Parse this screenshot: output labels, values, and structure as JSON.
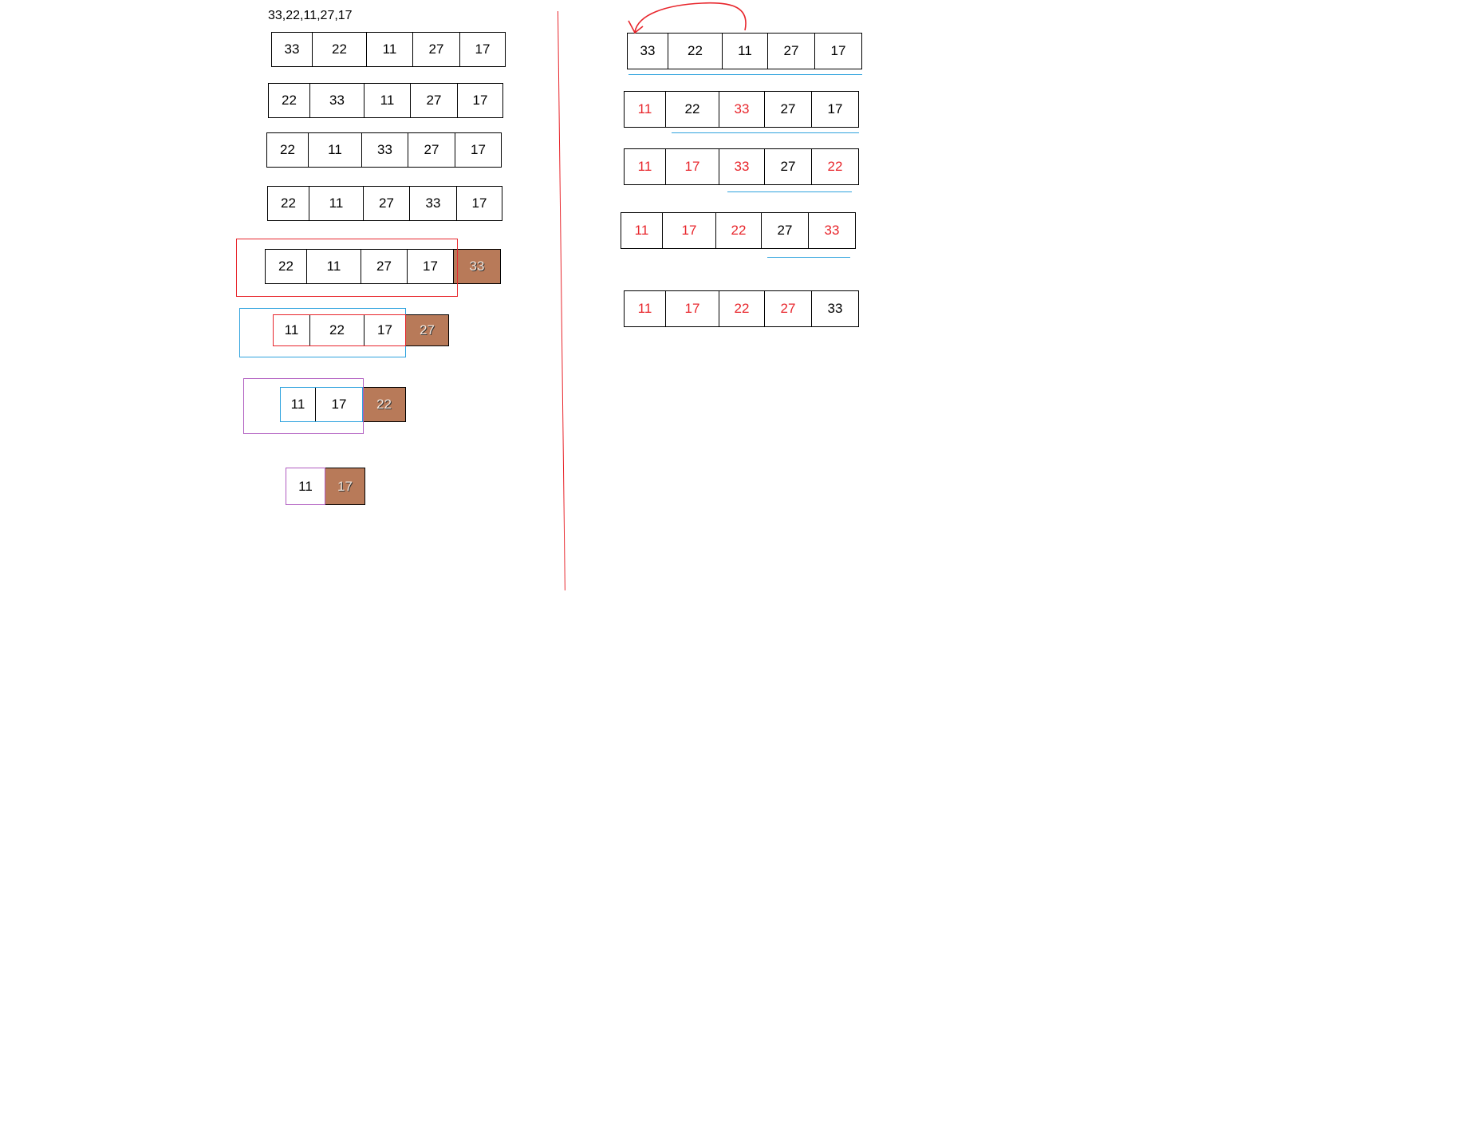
{
  "colors": {
    "black": "#000000",
    "red": "#e8262c",
    "cyan": "#2fa3de",
    "purple": "#b05cc0",
    "sorted_fill": "#b87a59"
  },
  "left_panel": {
    "input_label": "33,22,11,27,17",
    "rows": [
      [
        "33",
        "22",
        "11",
        "27",
        "17"
      ],
      [
        "22",
        "33",
        "11",
        "27",
        "17"
      ],
      [
        "22",
        "11",
        "33",
        "27",
        "17"
      ],
      [
        "22",
        "11",
        "27",
        "33",
        "17"
      ],
      [
        "22",
        "11",
        "27",
        "17",
        "33"
      ],
      [
        "11",
        "22",
        "17",
        "27"
      ],
      [
        "11",
        "17",
        "22"
      ],
      [
        "11",
        "17"
      ]
    ]
  },
  "right_panel": {
    "rows": [
      [
        "33",
        "22",
        "11",
        "27",
        "17"
      ],
      [
        "11",
        "22",
        "33",
        "27",
        "17"
      ],
      [
        "11",
        "17",
        "33",
        "27",
        "22"
      ],
      [
        "11",
        "17",
        "22",
        "27",
        "33"
      ],
      [
        "11",
        "17",
        "22",
        "27",
        "33"
      ]
    ]
  }
}
